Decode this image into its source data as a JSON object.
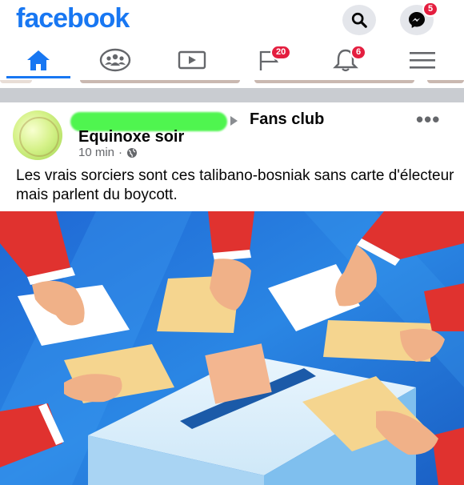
{
  "header": {
    "logo": "facebook",
    "search_icon": "search-icon",
    "messenger_icon": "messenger-icon",
    "messenger_badge": "5"
  },
  "nav": {
    "tabs": [
      {
        "name": "home",
        "icon": "home-icon",
        "badge": ""
      },
      {
        "name": "groups",
        "icon": "groups-icon",
        "badge": ""
      },
      {
        "name": "watch",
        "icon": "video-icon",
        "badge": ""
      },
      {
        "name": "pages",
        "icon": "flag-icon",
        "badge": "20"
      },
      {
        "name": "notifications",
        "icon": "bell-icon",
        "badge": "6"
      },
      {
        "name": "menu",
        "icon": "hamburger-icon",
        "badge": ""
      }
    ]
  },
  "post": {
    "group_name": "Fans club",
    "author": "Equinoxe soir",
    "time": "10 min",
    "separator": "·",
    "privacy_icon": "globe-icon",
    "more": "•••",
    "text": "Les vrais sorciers sont ces talibano-bosniak sans carte d'électeur mais parlent du boycott.",
    "image_subject": "ballot-box-voting-illustration"
  },
  "colors": {
    "brand": "#1877f2",
    "badge": "#e41e3f",
    "text": "#050505",
    "secondary": "#65676b"
  }
}
